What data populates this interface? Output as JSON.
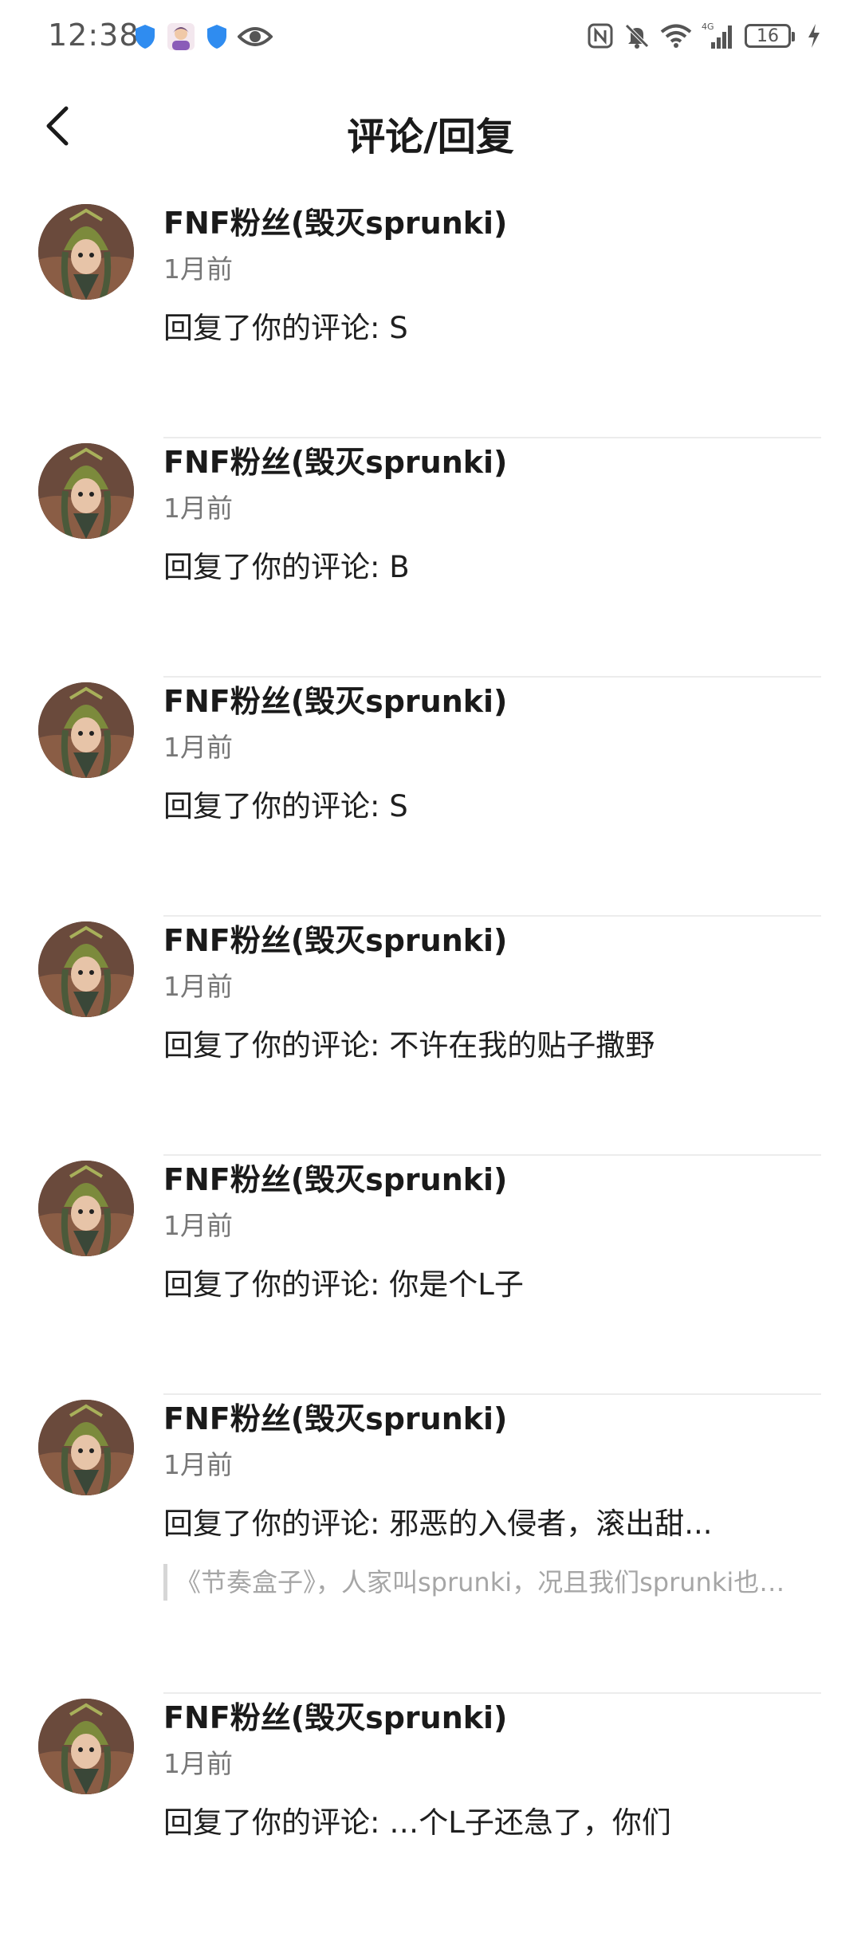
{
  "status_bar": {
    "time": "12:38",
    "battery_level": "16",
    "left_icons": [
      "shield-icon",
      "avatar-notification-icon",
      "shield-icon",
      "eye-icon"
    ],
    "right_icons": [
      "nfc-icon",
      "mute-bell-icon",
      "wifi-icon",
      "signal-4g-icon",
      "battery-icon",
      "charging-icon"
    ]
  },
  "header": {
    "title": "评论/回复",
    "back_icon": "chevron-left-icon"
  },
  "colors": {
    "quote_text": "#a6a6a6",
    "divider": "#ececec",
    "secondary_text": "#777777"
  },
  "replies": [
    {
      "user": "FNF粉丝(毁灭sprunki)",
      "time": "1月前",
      "text": "回复了你的评论: S"
    },
    {
      "user": "FNF粉丝(毁灭sprunki)",
      "time": "1月前",
      "text": "回复了你的评论: B"
    },
    {
      "user": "FNF粉丝(毁灭sprunki)",
      "time": "1月前",
      "text": "回复了你的评论: S"
    },
    {
      "user": "FNF粉丝(毁灭sprunki)",
      "time": "1月前",
      "text": "回复了你的评论: 不许在我的贴子撒野"
    },
    {
      "user": "FNF粉丝(毁灭sprunki)",
      "time": "1月前",
      "text": "回复了你的评论: 你是个L子"
    },
    {
      "user": "FNF粉丝(毁灭sprunki)",
      "time": "1月前",
      "text": "回复了你的评论: 邪恶的入侵者，滚出甜...",
      "quote": "《节奏盒子》，人家叫sprunki，况且我们sprunki也…"
    },
    {
      "user": "FNF粉丝(毁灭sprunki)",
      "time": "1月前",
      "text": "回复了你的评论: …个L子还急了，你们"
    }
  ]
}
